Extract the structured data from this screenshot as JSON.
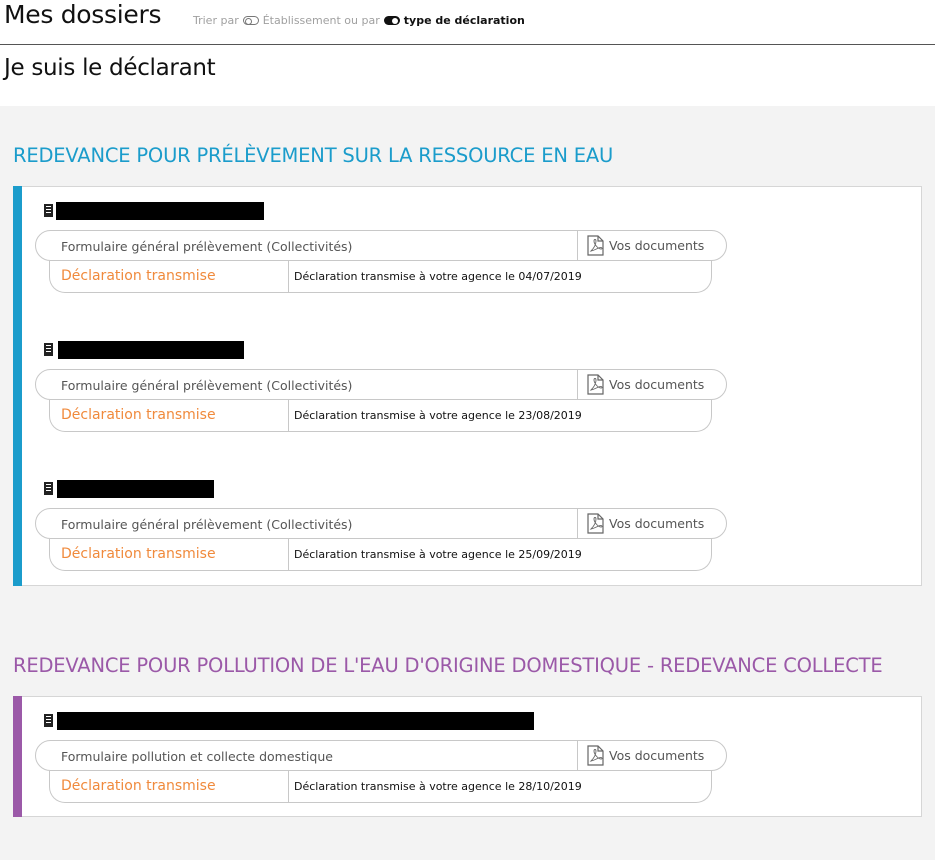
{
  "header": {
    "title": "Mes dossiers",
    "sort_prefix": "Trier par",
    "sort_option1": "Établissement ou par",
    "sort_option2": "type de déclaration"
  },
  "subtitle": "Je suis le déclarant",
  "colors": {
    "section1": "#1b9ccb",
    "section2": "#9b59a8",
    "status": "#f08a3c"
  },
  "sections": [
    {
      "title": "REDEVANCE POUR PRÉLÈVEMENT SUR LA RESSOURCE EN EAU",
      "items": [
        {
          "form": "Formulaire général prélèvement (Collectivités)",
          "docs_label": "Vos documents",
          "status": "Déclaration transmise",
          "detail": "Déclaration transmise à votre agence le 04/07/2019"
        },
        {
          "form": "Formulaire général prélèvement (Collectivités)",
          "docs_label": "Vos documents",
          "status": "Déclaration transmise",
          "detail": "Déclaration transmise à votre agence le 23/08/2019"
        },
        {
          "form": "Formulaire général prélèvement (Collectivités)",
          "docs_label": "Vos documents",
          "status": "Déclaration transmise",
          "detail": "Déclaration transmise à votre agence le 25/09/2019"
        }
      ]
    },
    {
      "title": "REDEVANCE POUR POLLUTION DE L'EAU D'ORIGINE DOMESTIQUE - REDEVANCE COLLECTE",
      "items": [
        {
          "form": "Formulaire pollution et collecte domestique",
          "docs_label": "Vos documents",
          "status": "Déclaration transmise",
          "detail": "Déclaration transmise à votre agence le 28/10/2019"
        }
      ]
    }
  ]
}
